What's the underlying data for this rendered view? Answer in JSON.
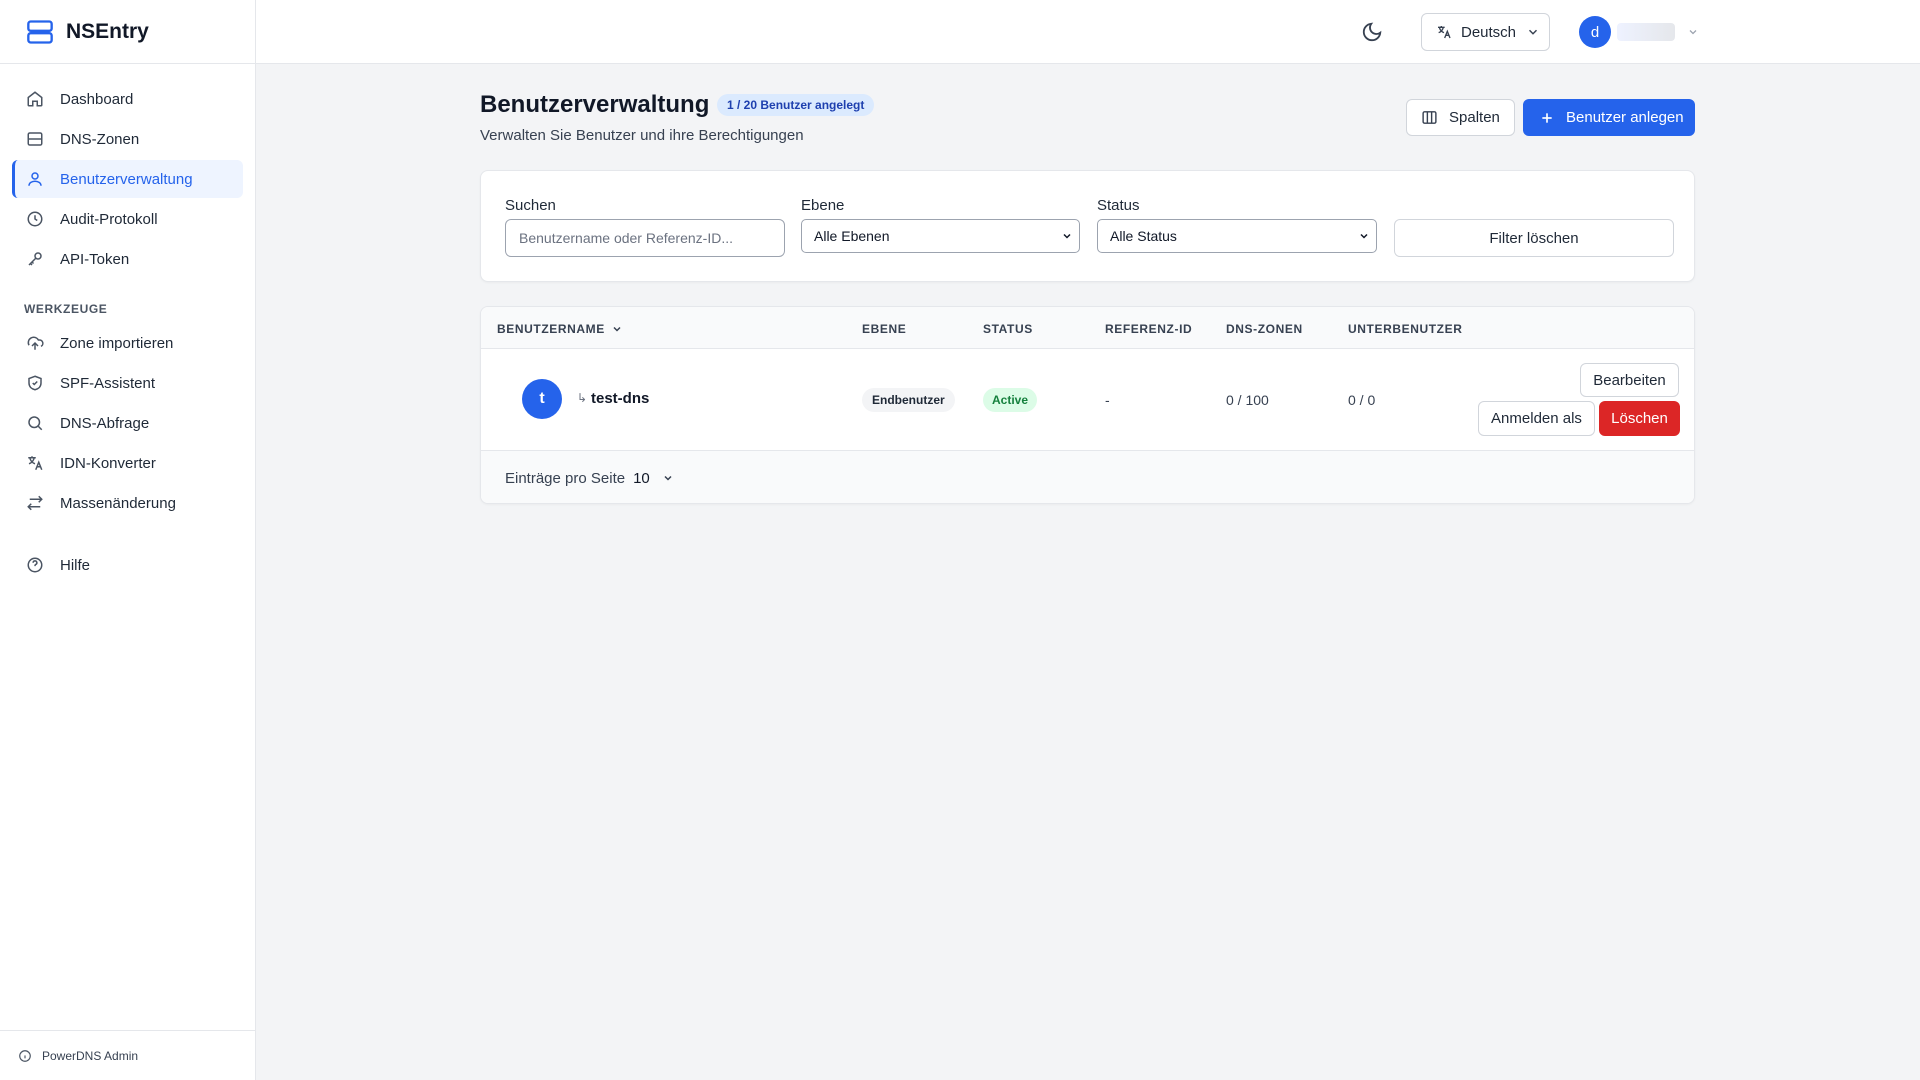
{
  "app": {
    "name": "NSEntry"
  },
  "sidebar": {
    "items": [
      {
        "label": "Dashboard",
        "icon": "home-icon"
      },
      {
        "label": "DNS-Zonen",
        "icon": "server-icon"
      },
      {
        "label": "Benutzerverwaltung",
        "icon": "users-icon",
        "active": true
      },
      {
        "label": "Audit-Protokoll",
        "icon": "clock-icon"
      },
      {
        "label": "API-Token",
        "icon": "key-icon"
      }
    ],
    "tools_title": "WERKZEUGE",
    "tools": [
      {
        "label": "Zone importieren",
        "icon": "upload-cloud-icon"
      },
      {
        "label": "SPF-Assistent",
        "icon": "shield-icon"
      },
      {
        "label": "DNS-Abfrage",
        "icon": "search-icon"
      },
      {
        "label": "IDN-Konverter",
        "icon": "translate-icon"
      },
      {
        "label": "Massenänderung",
        "icon": "arrows-swap-icon"
      }
    ],
    "help": {
      "label": "Hilfe",
      "icon": "help-circle-icon"
    },
    "footer": "PowerDNS Admin"
  },
  "topbar": {
    "language": "Deutsch",
    "user_initial": "d"
  },
  "page": {
    "title": "Benutzerverwaltung",
    "badge": "1 / 20 Benutzer angelegt",
    "subtitle": "Verwalten Sie Benutzer und ihre Berechtigungen",
    "columns_button": "Spalten",
    "new_user_button": "Benutzer anlegen"
  },
  "filters": {
    "search_label": "Suchen",
    "search_placeholder": "Benutzername oder Referenz-ID...",
    "level_label": "Ebene",
    "level_value": "Alle Ebenen",
    "status_label": "Status",
    "status_value": "Alle Status",
    "clear_button": "Filter löschen"
  },
  "table": {
    "headers": {
      "username": "BENUTZERNAME",
      "level": "EBENE",
      "status": "STATUS",
      "reference": "REFERENZ-ID",
      "zones": "DNS-ZONEN",
      "subusers": "UNTERBENUTZER"
    },
    "rows": [
      {
        "initial": "t",
        "sub_marker": "↳",
        "username": "test-dns",
        "level": "Endbenutzer",
        "status": "Active",
        "reference": "-",
        "zones": "0 / 100",
        "subusers": "0 / 0",
        "actions": {
          "edit": "Bearbeiten",
          "login_as": "Anmelden als",
          "delete": "Löschen"
        }
      }
    ],
    "footer": {
      "per_page_label": "Einträge pro Seite",
      "per_page_value": "10"
    }
  },
  "colors": {
    "primary": "#2563eb",
    "danger": "#dc2626",
    "success_bg": "#dcfce7",
    "success_text": "#15803d"
  }
}
